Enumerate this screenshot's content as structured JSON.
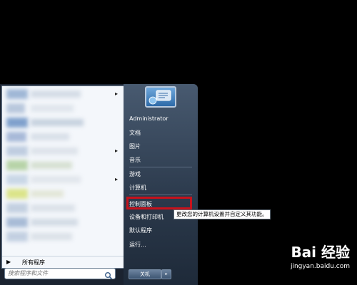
{
  "left_pane": {
    "all_programs_label": "所有程序",
    "search_placeholder": "搜索程序和文件"
  },
  "right_pane": {
    "items": [
      "Administrator",
      "文档",
      "图片",
      "音乐",
      "游戏",
      "计算机",
      "控制面板",
      "设备和打印机",
      "默认程序",
      "运行..."
    ],
    "highlighted_item": "控制面板"
  },
  "tooltip": "更改您的计算机设置并自定义其功能。",
  "shutdown": {
    "label": "关机",
    "arrow": "▸"
  },
  "watermark": {
    "logo_text": "Bai 经验",
    "url": "jingyan.baidu.com"
  },
  "colors": {
    "highlight_border": "#c6121c",
    "right_pane_top": "#485a70",
    "left_pane_bg": "#f4f7fb"
  }
}
